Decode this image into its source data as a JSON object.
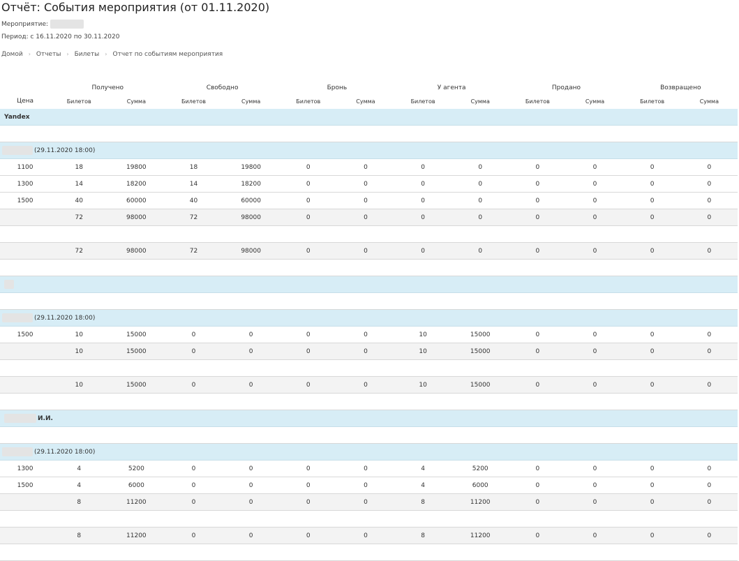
{
  "title": "Отчёт: События мероприятия (от 01.11.2020)",
  "event_label": "Мероприятие:",
  "period_label": "Период: с 16.11.2020 по 30.11.2020",
  "breadcrumb": [
    "Домой",
    "Отчеты",
    "Билеты",
    "Отчет по событиям мероприятия"
  ],
  "table": {
    "price_header": "Цена",
    "groups": [
      "Получено",
      "Свободно",
      "Бронь",
      "У агента",
      "Продано",
      "Возвращено"
    ],
    "sub_tickets": "Билетов",
    "sub_sum": "Сумма"
  },
  "agents": [
    {
      "name": "Yandex",
      "sessions": [
        {
          "label": "(29.11.2020 18:00)",
          "rows": [
            {
              "price": "1100",
              "v": [
                "18",
                "19800",
                "18",
                "19800",
                "0",
                "0",
                "0",
                "0",
                "0",
                "0",
                "0",
                "0"
              ]
            },
            {
              "price": "1300",
              "v": [
                "14",
                "18200",
                "14",
                "18200",
                "0",
                "0",
                "0",
                "0",
                "0",
                "0",
                "0",
                "0"
              ]
            },
            {
              "price": "1500",
              "v": [
                "40",
                "60000",
                "40",
                "60000",
                "0",
                "0",
                "0",
                "0",
                "0",
                "0",
                "0",
                "0"
              ]
            }
          ],
          "subtotal": [
            "72",
            "98000",
            "72",
            "98000",
            "0",
            "0",
            "0",
            "0",
            "0",
            "0",
            "0",
            "0"
          ]
        }
      ],
      "total": [
        "72",
        "98000",
        "72",
        "98000",
        "0",
        "0",
        "0",
        "0",
        "0",
        "0",
        "0",
        "0"
      ]
    },
    {
      "name": "",
      "sessions": [
        {
          "label": "(29.11.2020 18:00)",
          "rows": [
            {
              "price": "1500",
              "v": [
                "10",
                "15000",
                "0",
                "0",
                "0",
                "0",
                "10",
                "15000",
                "0",
                "0",
                "0",
                "0"
              ]
            }
          ],
          "subtotal": [
            "10",
            "15000",
            "0",
            "0",
            "0",
            "0",
            "10",
            "15000",
            "0",
            "0",
            "0",
            "0"
          ]
        }
      ],
      "total": [
        "10",
        "15000",
        "0",
        "0",
        "0",
        "0",
        "10",
        "15000",
        "0",
        "0",
        "0",
        "0"
      ]
    },
    {
      "name": "И.И.",
      "sessions": [
        {
          "label": "(29.11.2020 18:00)",
          "rows": [
            {
              "price": "1300",
              "v": [
                "4",
                "5200",
                "0",
                "0",
                "0",
                "0",
                "4",
                "5200",
                "0",
                "0",
                "0",
                "0"
              ]
            },
            {
              "price": "1500",
              "v": [
                "4",
                "6000",
                "0",
                "0",
                "0",
                "0",
                "4",
                "6000",
                "0",
                "0",
                "0",
                "0"
              ]
            }
          ],
          "subtotal": [
            "8",
            "11200",
            "0",
            "0",
            "0",
            "0",
            "8",
            "11200",
            "0",
            "0",
            "0",
            "0"
          ]
        }
      ],
      "total": [
        "8",
        "11200",
        "0",
        "0",
        "0",
        "0",
        "8",
        "11200",
        "0",
        "0",
        "0",
        "0"
      ]
    }
  ],
  "colors": {
    "band": "#d7edf6",
    "subtotal": "#f3f3f3",
    "border": "#d8d8d8"
  }
}
